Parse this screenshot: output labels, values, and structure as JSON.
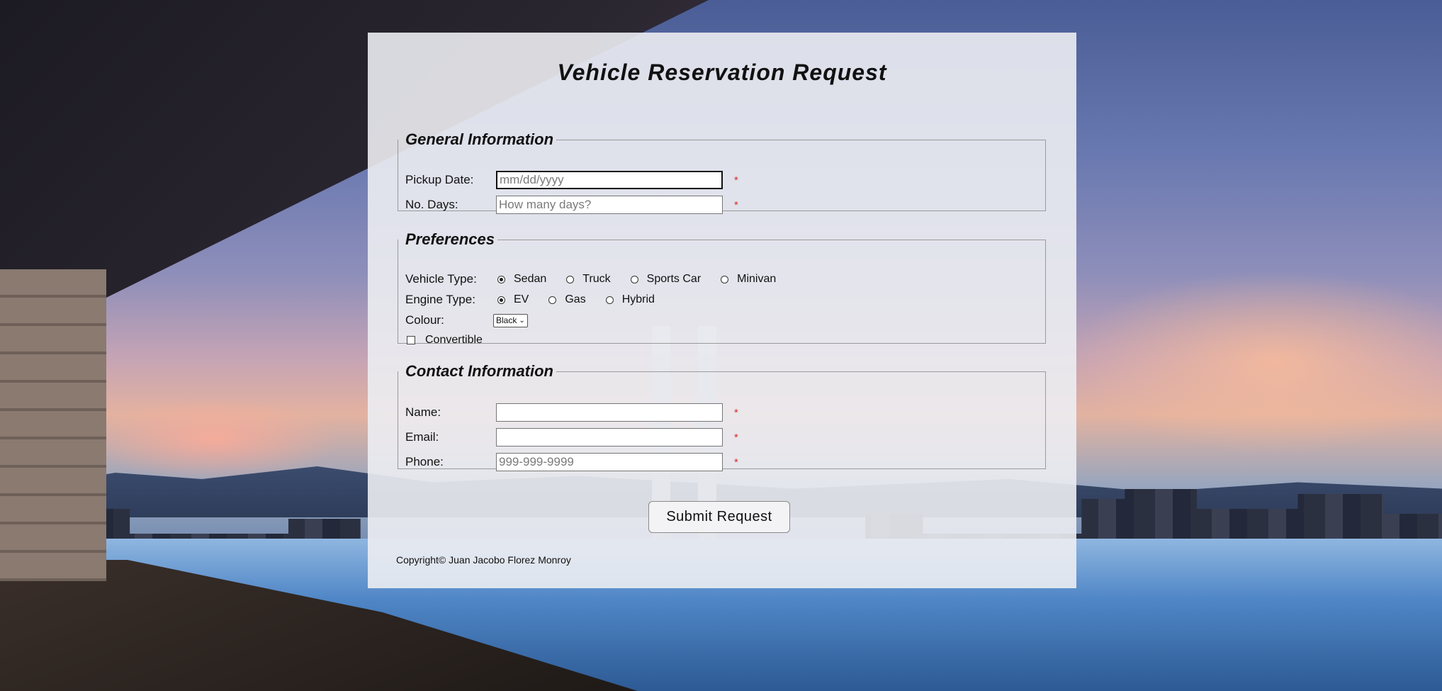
{
  "page": {
    "title": "Vehicle Reservation Request"
  },
  "general": {
    "legend": "General Information",
    "pickup_label": "Pickup Date:",
    "pickup_placeholder": "mm/dd/yyyy",
    "days_label": "No. Days:",
    "days_placeholder": "How many days?",
    "required_mark": "*"
  },
  "preferences": {
    "legend": "Preferences",
    "vehicle_label": "Vehicle Type:",
    "vehicle_options": [
      "Sedan",
      "Truck",
      "Sports Car",
      "Minivan"
    ],
    "vehicle_selected": "Sedan",
    "engine_label": "Engine Type:",
    "engine_options": [
      "EV",
      "Gas",
      "Hybrid"
    ],
    "engine_selected": "EV",
    "colour_label": "Colour:",
    "colour_value": "Black",
    "convertible_label": "Convertible",
    "convertible_checked": false
  },
  "contact": {
    "legend": "Contact Information",
    "name_label": "Name:",
    "name_value": "",
    "email_label": "Email:",
    "email_value": "",
    "phone_label": "Phone:",
    "phone_placeholder": "999-999-9999"
  },
  "actions": {
    "submit_label": "Submit Request"
  },
  "footer": {
    "copyright": "Copyright© Juan Jacobo Florez Monroy"
  },
  "icons": {
    "select_chevron": "chevron-down-icon"
  },
  "colors": {
    "required": "#d0302a",
    "card_background": "#ecedf2"
  }
}
